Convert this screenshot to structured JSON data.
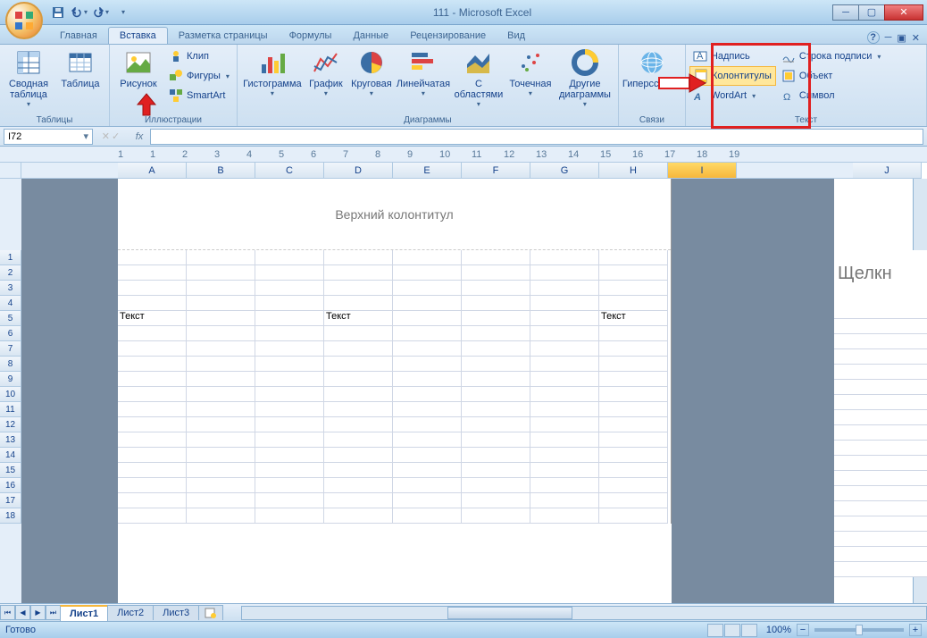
{
  "title": "111 - Microsoft Excel",
  "tabs": [
    "Главная",
    "Вставка",
    "Разметка страницы",
    "Формулы",
    "Данные",
    "Рецензирование",
    "Вид"
  ],
  "active_tab": 1,
  "ribbon": {
    "tables": {
      "pivot": "Сводная таблица",
      "table": "Таблица",
      "label": "Таблицы"
    },
    "illustr": {
      "picture": "Рисунок",
      "clip": "Клип",
      "shapes": "Фигуры",
      "smartart": "SmartArt",
      "label": "Иллюстрации"
    },
    "charts": {
      "histogram": "Гистограмма",
      "line": "График",
      "pie": "Круговая",
      "bar": "Линейчатая",
      "area": "С областями",
      "scatter": "Точечная",
      "other": "Другие диаграммы",
      "label": "Диаграммы"
    },
    "links": {
      "hyperlink": "Гиперссылка",
      "label": "Связи"
    },
    "text": {
      "textbox": "Надпись",
      "headers": "Колонтитулы",
      "wordart": "WordArt",
      "sigline": "Строка подписи",
      "object": "Объект",
      "symbol": "Символ",
      "label": "Текст"
    }
  },
  "namebox": "I72",
  "columns": [
    "A",
    "B",
    "C",
    "D",
    "E",
    "F",
    "G",
    "H",
    "I",
    "J"
  ],
  "selected_col": "I",
  "rows": [
    1,
    2,
    3,
    4,
    5,
    6,
    7,
    8,
    9,
    10,
    11,
    12,
    13,
    14,
    15,
    16,
    17,
    18
  ],
  "ruler": [
    "1",
    "1",
    "2",
    "3",
    "4",
    "5",
    "6",
    "7",
    "8",
    "9",
    "10",
    "11",
    "12",
    "13",
    "14",
    "15",
    "16",
    "17",
    "18",
    "19"
  ],
  "page_header": "Верхний колонтитул",
  "cell_text": "Текст",
  "page2_text": "Щелкн",
  "sheets": [
    "Лист1",
    "Лист2",
    "Лист3"
  ],
  "active_sheet": 0,
  "status": "Готово",
  "zoom": "100%"
}
